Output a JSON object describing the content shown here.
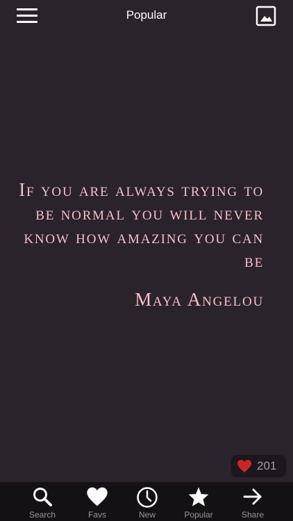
{
  "header": {
    "title": "Popular"
  },
  "quote": {
    "text": "If you are always trying to be normal you will never know how amazing you can be",
    "author": "Maya Angelou"
  },
  "likes": {
    "count": "201"
  },
  "tabs": [
    {
      "label": "Search",
      "icon": "search-icon"
    },
    {
      "label": "Favs",
      "icon": "heart-icon"
    },
    {
      "label": "New",
      "icon": "clock-icon"
    },
    {
      "label": "Popular",
      "icon": "star-icon"
    },
    {
      "label": "Share",
      "icon": "arrow-right-icon"
    }
  ],
  "colors": {
    "background": "#2b232b",
    "quote_text": "#f7bfc9",
    "tab_bar": "#131113",
    "heart": "#c62828"
  }
}
